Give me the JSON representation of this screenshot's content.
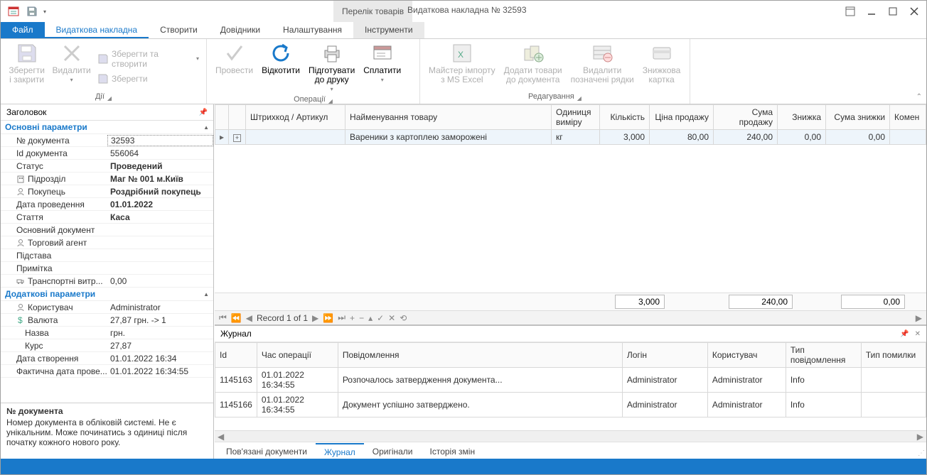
{
  "title": {
    "context_tab": "Перелік товарів",
    "doc": "Видаткова накладна № 32593"
  },
  "ribbon_tabs": {
    "file": "Файл",
    "active": "Видаткова накладна",
    "t2": "Створити",
    "t3": "Довідники",
    "t4": "Налаштування",
    "t5": "Інструменти"
  },
  "ribbon": {
    "group_actions": "Дії",
    "group_ops": "Операції",
    "group_edit": "Редагування",
    "save_close": "Зберегти\nі закрити",
    "delete": "Видалити",
    "save_create": "Зберегти та створити",
    "save": "Зберегти",
    "approve": "Провести",
    "rollback": "Відкотити",
    "print_prep": "Підготувати\nдо друку",
    "pay": "Сплатити",
    "excel_import": "Майстер імпорту\nз MS Excel",
    "add_goods": "Додати товари\nдо документа",
    "del_rows": "Видалити\nпозначені рядки",
    "discount": "Знижкова\nкартка"
  },
  "side": {
    "header": "Заголовок",
    "cat1": "Основні параметри",
    "cat2": "Додаткові параметри",
    "rows1": [
      {
        "k": "№ документа",
        "v": "32593",
        "sel": true,
        "ico": null
      },
      {
        "k": "Id документа",
        "v": "556064",
        "ico": null
      },
      {
        "k": "Статус",
        "v": "Проведений",
        "bold": true,
        "ico": null
      },
      {
        "k": "Підрозділ",
        "v": "Маг № 001 м.Київ",
        "bold": true,
        "ico": "building"
      },
      {
        "k": "Покупець",
        "v": "Роздрібний покупець",
        "bold": true,
        "ico": "person"
      },
      {
        "k": "Дата проведення",
        "v": "01.01.2022",
        "bold": true,
        "ico": null
      },
      {
        "k": "Стаття",
        "v": "Каса",
        "bold": true,
        "ico": null
      },
      {
        "k": "Основний документ",
        "v": "",
        "ico": null
      },
      {
        "k": "Торговий агент",
        "v": "",
        "ico": "person"
      },
      {
        "k": "Підстава",
        "v": "",
        "ico": null
      },
      {
        "k": "Примітка",
        "v": "",
        "ico": null
      },
      {
        "k": "Транспортні витр...",
        "v": "0,00",
        "ico": "truck"
      }
    ],
    "rows2": [
      {
        "k": "Користувач",
        "v": "Administrator",
        "ico": "person"
      },
      {
        "k": "Валюта",
        "v": "27,87 грн. -> 1",
        "ico": "currency"
      },
      {
        "k": "Назва",
        "v": "грн.",
        "ico": null,
        "indent": true
      },
      {
        "k": "Курс",
        "v": "27,87",
        "ico": null,
        "indent": true
      },
      {
        "k": "Дата створення",
        "v": "01.01.2022 16:34",
        "ico": null
      },
      {
        "k": "Фактична дата прове...",
        "v": "01.01.2022 16:34:55",
        "ico": null
      }
    ],
    "desc_title": "№ документа",
    "desc_body": "Номер документа в обліковій системі. Не є унікальним. Може починатись з одиниці після початку кожного нового року."
  },
  "grid": {
    "cols": {
      "barcode": "Штрихкод / Артикул",
      "name": "Найменування товару",
      "unit": "Одиниця виміру",
      "qty": "Кількість",
      "price": "Ціна продажу",
      "sum": "Сума продажу",
      "discount": "Знижка",
      "discount_sum": "Сума знижки",
      "comment": "Комен"
    },
    "rows": [
      {
        "barcode": "",
        "name": "Вареники з картоплею заморожені",
        "unit": "кг",
        "qty": "3,000",
        "price": "80,00",
        "sum": "240,00",
        "discount": "0,00",
        "discount_sum": "0,00"
      }
    ],
    "summary": {
      "qty": "3,000",
      "sum": "240,00",
      "discount_sum": "0,00"
    },
    "nav": "Record 1 of 1"
  },
  "journal": {
    "title": "Журнал",
    "cols": {
      "id": "Id",
      "time": "Час операції",
      "msg": "Повідомлення",
      "login": "Логін",
      "user": "Користувач",
      "type": "Тип повідомлення",
      "err": "Тип помилки"
    },
    "rows": [
      {
        "id": "1145163",
        "time": "01.01.2022 16:34:55",
        "msg": "Розпочалось затвердження документа...",
        "login": "Administrator",
        "user": "Administrator",
        "type": "Info",
        "err": ""
      },
      {
        "id": "1145166",
        "time": "01.01.2022 16:34:55",
        "msg": "Документ успішно затверджено.",
        "login": "Administrator",
        "user": "Administrator",
        "type": "Info",
        "err": ""
      }
    ],
    "tabs": {
      "t1": "Пов'язані документи",
      "t2": "Журнал",
      "t3": "Оригінали",
      "t4": "Історія змін"
    }
  }
}
